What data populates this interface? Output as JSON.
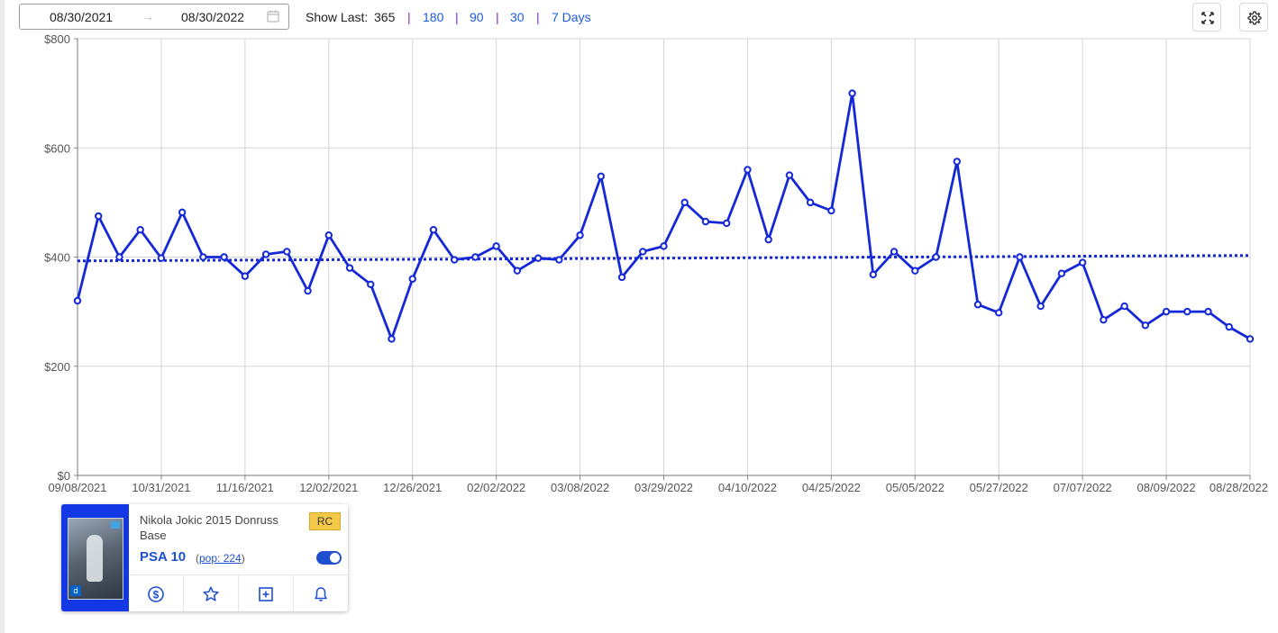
{
  "toolbar": {
    "start_date": "08/30/2021",
    "end_date": "08/30/2022",
    "show_last_label": "Show Last:",
    "ranges": [
      "365",
      "180",
      "90",
      "30",
      "7 Days"
    ],
    "active_range": "365",
    "separator": "|"
  },
  "icons": {
    "date_arrow": "→",
    "calendar": "calendar-icon",
    "fullscreen": "expand-icon",
    "settings": "gear-icon",
    "price": "dollar-icon",
    "favorite": "star-icon",
    "add": "plus-square-icon",
    "alert": "bell-icon"
  },
  "colors": {
    "series": "#1428d8",
    "link": "#1a5bd8",
    "card_accent": "#1437e6",
    "badge": "#f4c947"
  },
  "card": {
    "title": "Nikola Jokic 2015 Donruss Base",
    "badge": "RC",
    "grade": "PSA 10",
    "pop_open": "(",
    "pop_link": "pop: 224",
    "pop_close": ")",
    "toggle_on": true
  },
  "chart_data": {
    "type": "line",
    "ylim": [
      0,
      800
    ],
    "y_ticks": [
      0,
      200,
      400,
      600,
      800
    ],
    "y_tick_labels": [
      "$0",
      "$200",
      "$400",
      "$600",
      "$800"
    ],
    "x_tick_labels": [
      "09/08/2021",
      "10/31/2021",
      "11/16/2021",
      "12/02/2021",
      "12/26/2021",
      "02/02/2022",
      "03/08/2022",
      "03/29/2022",
      "04/10/2022",
      "04/25/2022",
      "05/05/2022",
      "05/27/2022",
      "07/07/2022",
      "08/09/2022",
      "08/28/2022"
    ],
    "grid": true,
    "series": [
      {
        "style": "solid-markers",
        "values": [
          320,
          475,
          400,
          450,
          398,
          482,
          400,
          400,
          365,
          405,
          410,
          338,
          440,
          380,
          350,
          250,
          360,
          450,
          395,
          400,
          420,
          375,
          398,
          395,
          440,
          548,
          363,
          410,
          420,
          500,
          465,
          462,
          560,
          432,
          550,
          500,
          485,
          700,
          368,
          410,
          375,
          400,
          575,
          313,
          298,
          400,
          310,
          370,
          390,
          285,
          310,
          275,
          300,
          300,
          300,
          272,
          250
        ]
      },
      {
        "style": "dotted-trend",
        "values": [
          393,
          403
        ]
      }
    ]
  }
}
